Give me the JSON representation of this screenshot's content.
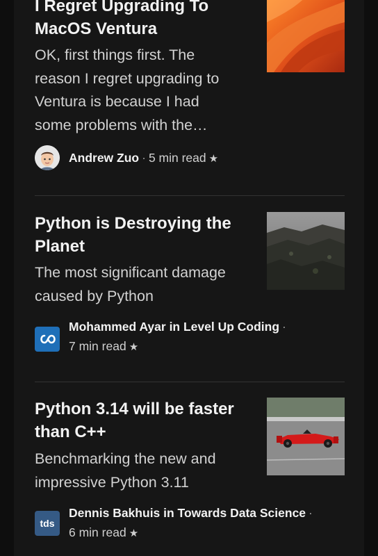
{
  "articles": [
    {
      "title_line1": "I Regret Upgrading To",
      "title_line2": "MacOS Ventura",
      "subtitle_lines": [
        "OK, first things first. The",
        "reason I regret upgrading to",
        "Ventura is because I had",
        "some problems with the…"
      ],
      "author": "Andrew Zuo",
      "read_time": "5 min read",
      "thumb_icon": "macos-ventura-wallpaper-image"
    },
    {
      "title_line1": "Python is Destroying the",
      "title_line2": "Planet",
      "subtitle_lines": [
        "The most significant damage",
        "caused by Python"
      ],
      "author": "Mohammed Ayar in Level Up Coding",
      "read_time": "7 min read",
      "pub_icon": "level-up-coding-logo",
      "thumb_icon": "mountain-landscape-image"
    },
    {
      "title_line1": "Python 3.14 will be faster",
      "title_line2": "than C++",
      "subtitle_lines": [
        "Benchmarking the new and",
        "impressive Python 3.11"
      ],
      "author": "Dennis Bakhuis in Towards Data Science",
      "read_time": "6 min read",
      "pub_icon_text": "tds",
      "thumb_icon": "race-car-image"
    }
  ],
  "colors": {
    "background": "#161616",
    "level_up_blue": "#1f6fb8",
    "tds_blue": "#355a85"
  }
}
